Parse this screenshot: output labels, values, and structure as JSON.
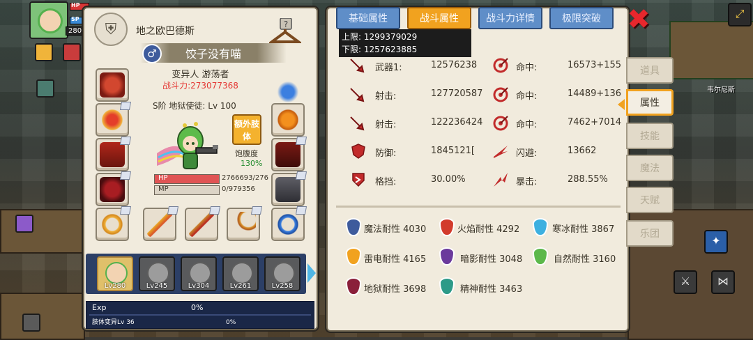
{
  "hud": {
    "level": "280",
    "hp_label": "HP",
    "sp_label": "SP"
  },
  "character": {
    "guild_name": "地之欧巴德斯",
    "player_name": "饺子没有喵",
    "class_line": "变异人 游荡者",
    "power": "战斗力:273077368",
    "rank_line": "S阶 地狱使徒: Lv 100",
    "extra_limb": "额外肢体",
    "satiety_label": "饱腹度",
    "satiety_value": "130%",
    "hp": {
      "label": "HP",
      "text": "2766693/276",
      "fill_fraction": 1.0
    },
    "mp": {
      "label": "MP",
      "text": "0/979356",
      "fill_fraction": 0.0
    }
  },
  "party": [
    {
      "level": "Lv280",
      "active": true
    },
    {
      "level": "Lv245",
      "active": false
    },
    {
      "level": "Lv304",
      "active": false
    },
    {
      "level": "Lv261",
      "active": false
    },
    {
      "level": "Lv258",
      "active": false
    }
  ],
  "exp": {
    "label": "Exp",
    "value": "0%",
    "limb_label": "肢体变异Lv 36",
    "limb_value": "0%"
  },
  "tabs": {
    "base": "基础属性",
    "combat": "战斗属性",
    "detail": "战斗力详情",
    "breakthrough": "极限突破"
  },
  "tooltip": {
    "upper": "上限: 1299379029",
    "lower": "下限: 1257623885"
  },
  "stats": {
    "weapon_label": "武器1:",
    "weapon_value": "12576238",
    "shoot1_label": "射击:",
    "shoot1_value": "127720587",
    "shoot2_label": "射击:",
    "shoot2_value": "122236424",
    "defense_label": "防御:",
    "defense_value": "1845121[",
    "block_label": "格挡:",
    "block_value": "30.00%",
    "hit1_label": "命中:",
    "hit1_value": "16573+155",
    "hit2_label": "命中:",
    "hit2_value": "14489+136",
    "hit3_label": "命中:",
    "hit3_value": "7462+7014",
    "dodge_label": "闪避:",
    "dodge_value": "13662",
    "crit_label": "暴击:",
    "crit_value": "288.55%"
  },
  "resist": {
    "magic": "魔法耐性 4030",
    "fire": "火焰耐性 4292",
    "ice": "寒冰耐性 3867",
    "thunder": "雷电耐性 4165",
    "shadow": "暗影耐性 3048",
    "nature": "自然耐性 3160",
    "hell": "地狱耐性 3698",
    "spirit": "精神耐性 3463"
  },
  "side_nav": {
    "items": "道具",
    "attributes": "属性",
    "skills": "技能",
    "magic": "魔法",
    "talent": "天赋",
    "band": "乐团"
  },
  "map": {
    "location": "韦尔尼斯"
  },
  "colors": {
    "accent": "#f1a21f",
    "tab_blue": "#5f8ec8",
    "power_red": "#e53935",
    "satiety_green": "#1f8a2b"
  }
}
